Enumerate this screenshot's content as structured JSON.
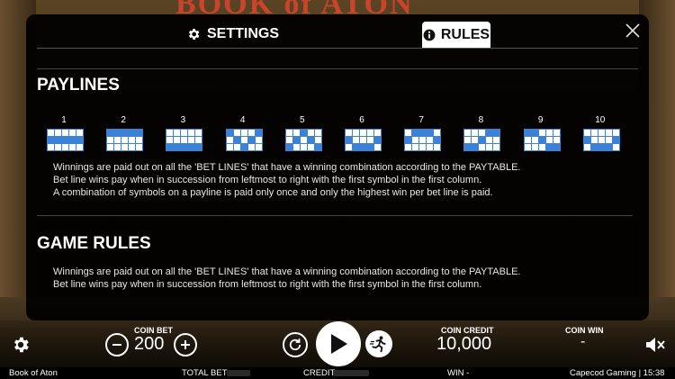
{
  "game": {
    "title": "Book of Aton",
    "logo_text": "BOOK of ATON"
  },
  "tabs": {
    "settings_label": "SETTINGS",
    "rules_label": "RULES"
  },
  "rules": {
    "paylines_title": "PAYLINES",
    "paylines": [
      {
        "num": "1",
        "pattern": [
          [
            0,
            0,
            0,
            0,
            0
          ],
          [
            1,
            1,
            1,
            1,
            1
          ],
          [
            0,
            0,
            0,
            0,
            0
          ]
        ]
      },
      {
        "num": "2",
        "pattern": [
          [
            1,
            1,
            1,
            1,
            1
          ],
          [
            0,
            0,
            0,
            0,
            0
          ],
          [
            0,
            0,
            0,
            0,
            0
          ]
        ]
      },
      {
        "num": "3",
        "pattern": [
          [
            0,
            0,
            0,
            0,
            0
          ],
          [
            0,
            0,
            0,
            0,
            0
          ],
          [
            1,
            1,
            1,
            1,
            1
          ]
        ]
      },
      {
        "num": "4",
        "pattern": [
          [
            1,
            0,
            0,
            0,
            1
          ],
          [
            0,
            1,
            0,
            1,
            0
          ],
          [
            0,
            0,
            1,
            0,
            0
          ]
        ]
      },
      {
        "num": "5",
        "pattern": [
          [
            0,
            0,
            1,
            0,
            0
          ],
          [
            0,
            1,
            0,
            1,
            0
          ],
          [
            1,
            0,
            0,
            0,
            1
          ]
        ]
      },
      {
        "num": "6",
        "pattern": [
          [
            0,
            0,
            0,
            0,
            0
          ],
          [
            1,
            0,
            0,
            0,
            1
          ],
          [
            0,
            1,
            1,
            1,
            0
          ]
        ]
      },
      {
        "num": "7",
        "pattern": [
          [
            0,
            1,
            1,
            1,
            0
          ],
          [
            1,
            0,
            0,
            0,
            1
          ],
          [
            0,
            0,
            0,
            0,
            0
          ]
        ]
      },
      {
        "num": "8",
        "pattern": [
          [
            0,
            0,
            0,
            1,
            1
          ],
          [
            0,
            0,
            1,
            0,
            0
          ],
          [
            1,
            1,
            0,
            0,
            0
          ]
        ]
      },
      {
        "num": "9",
        "pattern": [
          [
            1,
            1,
            0,
            0,
            0
          ],
          [
            0,
            0,
            1,
            0,
            0
          ],
          [
            0,
            0,
            0,
            1,
            1
          ]
        ]
      },
      {
        "num": "10",
        "pattern": [
          [
            0,
            0,
            0,
            0,
            0
          ],
          [
            1,
            0,
            0,
            0,
            1
          ],
          [
            0,
            1,
            1,
            1,
            0
          ]
        ]
      }
    ],
    "paylines_text": [
      "Winnings are paid out on all the 'BET LINES' that have a winning combination according to the PAYTABLE.",
      "Bet line wins pay when in succession from leftmost to right with the first symbol in the first column.",
      "A combination of symbols on a payline is paid only once and only the highest win per bet line is paid."
    ],
    "game_rules_title": "GAME RULES",
    "game_rules_text": [
      "Winnings are paid out on all the 'BET LINES' that have a winning combination according to the PAYTABLE.",
      "Bet line wins pay when in succession from leftmost to right with the first symbol in the first column."
    ]
  },
  "controls": {
    "coin_bet_label": "COIN BET",
    "coin_bet_value": "200",
    "coin_credit_label": "COIN CREDIT",
    "coin_credit_value": "10,000",
    "coin_win_label": "COIN WIN",
    "coin_win_value": "-"
  },
  "footer": {
    "game_name": "Book of Aton",
    "total_bet_label": "TOTAL BET",
    "credit_label": "CREDIT",
    "win_label": "WIN -",
    "provider_time": "Capecod Gaming | 15:38"
  },
  "colors": {
    "payline_blue": "#3b82d6",
    "panel": "#000000"
  }
}
